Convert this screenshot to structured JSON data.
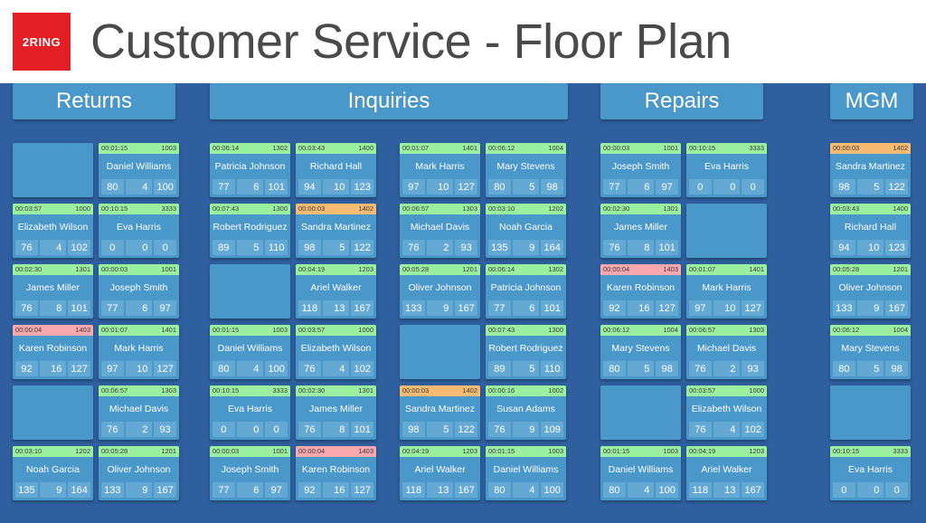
{
  "header": {
    "logo_text": "2RING",
    "title": "Customer Service - Floor Plan"
  },
  "colors": {
    "background": "#2f5f9e",
    "header_bar": "#ffffff",
    "tile": "#4a97c9",
    "stat_box": "#63a9d4",
    "logo_red": "#e31e24",
    "status_available": "#9bf0a0",
    "status_busy": "#f7bb72",
    "status_unavailable": "#f9a8ae",
    "title_text": "#4a4a4a"
  },
  "sections": [
    {
      "name": "Returns",
      "label": "Returns",
      "columns": [
        [
          {
            "empty": true
          },
          {
            "empty": false,
            "status": "green",
            "time": "00:03:57",
            "ext": "1000",
            "agent": "Elizabeth Wilson",
            "stats": [
              "76",
              "4",
              "102"
            ]
          },
          {
            "empty": false,
            "status": "green",
            "time": "00:02:30",
            "ext": "1301",
            "agent": "James Miller",
            "stats": [
              "76",
              "8",
              "101"
            ]
          },
          {
            "empty": false,
            "status": "red",
            "time": "00:00:04",
            "ext": "1403",
            "agent": "Karen Robinson",
            "stats": [
              "92",
              "16",
              "127"
            ]
          },
          {
            "empty": true
          },
          {
            "empty": false,
            "status": "green",
            "time": "00:03:10",
            "ext": "1202",
            "agent": "Noah Garcia",
            "stats": [
              "135",
              "9",
              "164"
            ]
          }
        ],
        [
          {
            "empty": false,
            "status": "green",
            "time": "00:01:15",
            "ext": "1003",
            "agent": "Daniel Williams",
            "stats": [
              "80",
              "4",
              "100"
            ]
          },
          {
            "empty": false,
            "status": "green",
            "time": "00:10:15",
            "ext": "3333",
            "agent": "Eva Harris",
            "stats": [
              "0",
              "0",
              "0"
            ]
          },
          {
            "empty": false,
            "status": "green",
            "time": "00:00:03",
            "ext": "1001",
            "agent": "Joseph Smith",
            "stats": [
              "77",
              "6",
              "97"
            ]
          },
          {
            "empty": false,
            "status": "green",
            "time": "00:01:07",
            "ext": "1401",
            "agent": "Mark Harris",
            "stats": [
              "97",
              "10",
              "127"
            ]
          },
          {
            "empty": false,
            "status": "green",
            "time": "00:06:57",
            "ext": "1303",
            "agent": "Michael Davis",
            "stats": [
              "76",
              "2",
              "93"
            ]
          },
          {
            "empty": false,
            "status": "green",
            "time": "00:05:28",
            "ext": "1201",
            "agent": "Oliver Johnson",
            "stats": [
              "133",
              "9",
              "167"
            ]
          }
        ]
      ]
    },
    {
      "name": "Inquiries",
      "label": "Inquiries",
      "columns": [
        [
          {
            "empty": false,
            "status": "green",
            "time": "00:06:14",
            "ext": "1302",
            "agent": "Patricia Johnson",
            "stats": [
              "77",
              "6",
              "101"
            ]
          },
          {
            "empty": false,
            "status": "green",
            "time": "00:07:43",
            "ext": "1300",
            "agent": "Robert Rodriguez",
            "stats": [
              "89",
              "5",
              "110"
            ]
          },
          {
            "empty": true
          },
          {
            "empty": false,
            "status": "green",
            "time": "00:01:15",
            "ext": "1003",
            "agent": "Daniel Williams",
            "stats": [
              "80",
              "4",
              "100"
            ]
          },
          {
            "empty": false,
            "status": "green",
            "time": "00:10:15",
            "ext": "3333",
            "agent": "Eva Harris",
            "stats": [
              "0",
              "0",
              "0"
            ]
          },
          {
            "empty": false,
            "status": "green",
            "time": "00:00:03",
            "ext": "1001",
            "agent": "Joseph Smith",
            "stats": [
              "77",
              "6",
              "97"
            ]
          }
        ],
        [
          {
            "empty": false,
            "status": "green",
            "time": "00:03:43",
            "ext": "1400",
            "agent": "Richard Hall",
            "stats": [
              "94",
              "10",
              "123"
            ]
          },
          {
            "empty": false,
            "status": "orange",
            "time": "00:00:03",
            "ext": "1402",
            "agent": "Sandra Martinez",
            "stats": [
              "98",
              "5",
              "122"
            ]
          },
          {
            "empty": false,
            "status": "green",
            "time": "00:04:19",
            "ext": "1203",
            "agent": "Ariel Walker",
            "stats": [
              "118",
              "13",
              "167"
            ]
          },
          {
            "empty": false,
            "status": "green",
            "time": "00:03:57",
            "ext": "1000",
            "agent": "Elizabeth Wilson",
            "stats": [
              "76",
              "4",
              "102"
            ]
          },
          {
            "empty": false,
            "status": "green",
            "time": "00:02:30",
            "ext": "1301",
            "agent": "James Miller",
            "stats": [
              "76",
              "8",
              "101"
            ]
          },
          {
            "empty": false,
            "status": "red",
            "time": "00:00:04",
            "ext": "1403",
            "agent": "Karen Robinson",
            "stats": [
              "92",
              "16",
              "127"
            ]
          }
        ],
        [
          {
            "empty": false,
            "status": "green",
            "time": "00:01:07",
            "ext": "1401",
            "agent": "Mark Harris",
            "stats": [
              "97",
              "10",
              "127"
            ]
          },
          {
            "empty": false,
            "status": "green",
            "time": "00:06:57",
            "ext": "1303",
            "agent": "Michael Davis",
            "stats": [
              "76",
              "2",
              "93"
            ]
          },
          {
            "empty": false,
            "status": "green",
            "time": "00:05:28",
            "ext": "1201",
            "agent": "Oliver Johnson",
            "stats": [
              "133",
              "9",
              "167"
            ]
          },
          {
            "empty": true
          },
          {
            "empty": false,
            "status": "orange",
            "time": "00:00:03",
            "ext": "1402",
            "agent": "Sandra Martinez",
            "stats": [
              "98",
              "5",
              "122"
            ]
          },
          {
            "empty": false,
            "status": "green",
            "time": "00:04:19",
            "ext": "1203",
            "agent": "Ariel Walker",
            "stats": [
              "118",
              "13",
              "167"
            ]
          }
        ],
        [
          {
            "empty": false,
            "status": "green",
            "time": "00:06:12",
            "ext": "1004",
            "agent": "Mary Stevens",
            "stats": [
              "80",
              "5",
              "98"
            ]
          },
          {
            "empty": false,
            "status": "green",
            "time": "00:03:10",
            "ext": "1202",
            "agent": "Noah Garcia",
            "stats": [
              "135",
              "9",
              "164"
            ]
          },
          {
            "empty": false,
            "status": "green",
            "time": "00:06:14",
            "ext": "1302",
            "agent": "Patricia Johnson",
            "stats": [
              "77",
              "6",
              "101"
            ]
          },
          {
            "empty": false,
            "status": "green",
            "time": "00:07:43",
            "ext": "1300",
            "agent": "Robert Rodriguez",
            "stats": [
              "89",
              "5",
              "110"
            ]
          },
          {
            "empty": false,
            "status": "green",
            "time": "00:00:16",
            "ext": "1002",
            "agent": "Susan Adams",
            "stats": [
              "76",
              "9",
              "109"
            ]
          },
          {
            "empty": false,
            "status": "green",
            "time": "00:01:15",
            "ext": "1003",
            "agent": "Daniel Williams",
            "stats": [
              "80",
              "4",
              "100"
            ]
          }
        ]
      ]
    },
    {
      "name": "Repairs",
      "label": "Repairs",
      "columns": [
        [
          {
            "empty": false,
            "status": "green",
            "time": "00:00:03",
            "ext": "1001",
            "agent": "Joseph Smith",
            "stats": [
              "77",
              "6",
              "97"
            ]
          },
          {
            "empty": false,
            "status": "green",
            "time": "00:02:30",
            "ext": "1301",
            "agent": "James Miller",
            "stats": [
              "76",
              "8",
              "101"
            ]
          },
          {
            "empty": false,
            "status": "red",
            "time": "00:00:04",
            "ext": "1403",
            "agent": "Karen Robinson",
            "stats": [
              "92",
              "16",
              "127"
            ]
          },
          {
            "empty": false,
            "status": "green",
            "time": "00:06:12",
            "ext": "1004",
            "agent": "Mary Stevens",
            "stats": [
              "80",
              "5",
              "98"
            ]
          },
          {
            "empty": true
          },
          {
            "empty": false,
            "status": "green",
            "time": "00:01:15",
            "ext": "1003",
            "agent": "Daniel Williams",
            "stats": [
              "80",
              "4",
              "100"
            ]
          }
        ],
        [
          {
            "empty": false,
            "status": "green",
            "time": "00:10:15",
            "ext": "3333",
            "agent": "Eva Harris",
            "stats": [
              "0",
              "0",
              "0"
            ]
          },
          {
            "empty": true
          },
          {
            "empty": false,
            "status": "green",
            "time": "00:01:07",
            "ext": "1401",
            "agent": "Mark Harris",
            "stats": [
              "97",
              "10",
              "127"
            ]
          },
          {
            "empty": false,
            "status": "green",
            "time": "00:06:57",
            "ext": "1303",
            "agent": "Michael Davis",
            "stats": [
              "76",
              "2",
              "93"
            ]
          },
          {
            "empty": false,
            "status": "green",
            "time": "00:03:57",
            "ext": "1000",
            "agent": "Elizabeth Wilson",
            "stats": [
              "76",
              "4",
              "102"
            ]
          },
          {
            "empty": false,
            "status": "green",
            "time": "00:04:19",
            "ext": "1203",
            "agent": "Ariel Walker",
            "stats": [
              "118",
              "13",
              "167"
            ]
          }
        ]
      ]
    },
    {
      "name": "MGM",
      "label": "MGM",
      "columns": [
        [
          {
            "empty": false,
            "status": "orange",
            "time": "00:00:03",
            "ext": "1402",
            "agent": "Sandra Martinez",
            "stats": [
              "98",
              "5",
              "122"
            ]
          },
          {
            "empty": false,
            "status": "green",
            "time": "00:03:43",
            "ext": "1400",
            "agent": "Richard Hall",
            "stats": [
              "94",
              "10",
              "123"
            ]
          },
          {
            "empty": false,
            "status": "green",
            "time": "00:05:28",
            "ext": "1201",
            "agent": "Oliver Johnson",
            "stats": [
              "133",
              "9",
              "167"
            ]
          },
          {
            "empty": false,
            "status": "green",
            "time": "00:06:12",
            "ext": "1004",
            "agent": "Mary Stevens",
            "stats": [
              "80",
              "5",
              "98"
            ]
          },
          {
            "empty": true
          },
          {
            "empty": false,
            "status": "green",
            "time": "00:10:15",
            "ext": "3333",
            "agent": "Eva Harris",
            "stats": [
              "0",
              "0",
              "0"
            ]
          }
        ]
      ]
    }
  ]
}
